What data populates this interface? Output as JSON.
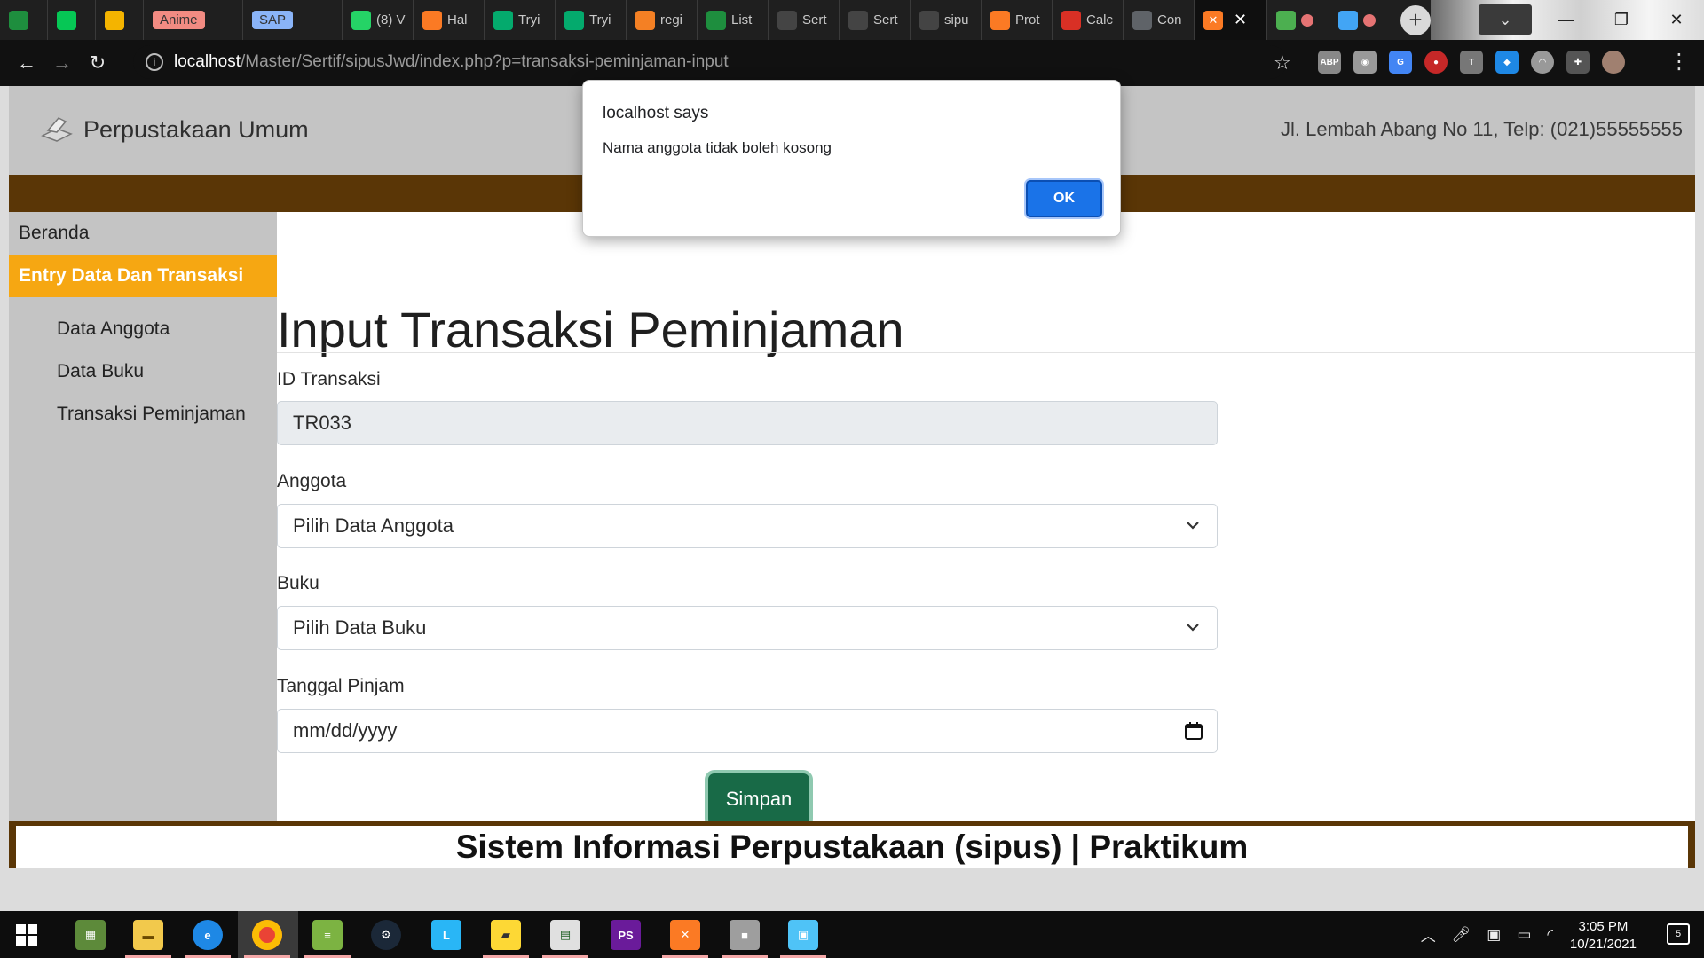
{
  "browser": {
    "tabs": [
      {
        "label": "",
        "icon": "sheets-plus-icon",
        "color": "#1e8e3e"
      },
      {
        "label": "",
        "icon": "line-app-icon",
        "color": "#06c755"
      },
      {
        "label": "",
        "icon": "google-drive-icon",
        "color": "#f4b400"
      },
      {
        "label": "Anime",
        "icon": "chip",
        "color": "#f28b82"
      },
      {
        "label": "SAP",
        "icon": "chip",
        "color": "#8ab4f8"
      },
      {
        "label": "(8) V",
        "icon": "whatsapp-icon",
        "color": "#25d366"
      },
      {
        "label": "Hal",
        "icon": "xampp-icon",
        "color": "#fb7a24"
      },
      {
        "label": "Tryi",
        "icon": "w3schools-icon",
        "color": "#04aa6d"
      },
      {
        "label": "Tryi",
        "icon": "w3schools-icon",
        "color": "#04aa6d"
      },
      {
        "label": "regi",
        "icon": "stackoverflow-icon",
        "color": "#f48024"
      },
      {
        "label": "List",
        "icon": "sheets-plus-icon",
        "color": "#1e8e3e"
      },
      {
        "label": "Sert",
        "icon": "github-icon",
        "color": "#444444"
      },
      {
        "label": "Sert",
        "icon": "github-icon",
        "color": "#444444"
      },
      {
        "label": "sipu",
        "icon": "github-icon",
        "color": "#444444"
      },
      {
        "label": "Prot",
        "icon": "xampp-icon",
        "color": "#fb7a24"
      },
      {
        "label": "Calc",
        "icon": "triangle-icon",
        "color": "#d93025"
      },
      {
        "label": "Con",
        "icon": "t-icon",
        "color": "#5f6368"
      }
    ],
    "active_tab_icon": "xampp-icon",
    "new_tab_label": "+",
    "url_host": "localhost",
    "url_path": "/Master/Sertif/sipusJwd/index.php?p=transaksi-peminjaman-input"
  },
  "site": {
    "brand": "Perpustakaan Umum",
    "address": "Jl. Lembah Abang No 11, Telp: (021)55555555",
    "sidebar": {
      "home": "Beranda",
      "section": "Entry Data Dan Transaksi",
      "items": [
        "Data Anggota",
        "Data Buku",
        "Transaksi Peminjaman"
      ]
    },
    "footer": "Sistem Informasi Perpustakaan (sipus) | Praktikum"
  },
  "form": {
    "title": "Input Transaksi Peminjaman",
    "id_label": "ID Transaksi",
    "id_value": "TR033",
    "anggota_label": "Anggota",
    "anggota_selected": "Pilih Data Anggota",
    "buku_label": "Buku",
    "buku_selected": "Pilih Data Buku",
    "tanggal_label": "Tanggal Pinjam",
    "tanggal_placeholder": "mm/dd/yyyy",
    "submit": "Simpan"
  },
  "dialog": {
    "title": "localhost says",
    "message": "Nama anggota tidak boleh kosong",
    "ok": "OK"
  },
  "taskbar": {
    "time": "3:05 PM",
    "date": "10/21/2021",
    "notifications": "5"
  },
  "colors": {
    "header_gray": "#c4c4c4",
    "brown": "#5a3606",
    "sidebar_active": "#f6a712",
    "button_green": "#186a47",
    "dialog_blue": "#1a73e8"
  }
}
